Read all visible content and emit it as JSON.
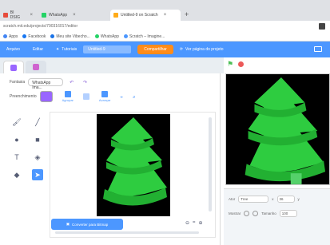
{
  "browser": {
    "tabs": [
      {
        "label": "BI DSIG",
        "favicon_color": "#e74c3c"
      },
      {
        "label": "WhatsApp",
        "favicon_color": "#25d366"
      },
      {
        "label": "Untitled-9 on Scratch",
        "favicon_color": "#ffab19"
      }
    ],
    "new_tab_glyph": "+",
    "close_glyph": "×",
    "url": "scratch.mit.edu/projects/790316017/editor",
    "bookmarks": [
      {
        "label": "Apps",
        "color": "#4285f4"
      },
      {
        "label": "Facebook",
        "color": "#1877f2"
      },
      {
        "label": "Meu site Vibecho...",
        "color": "#1a73e8"
      },
      {
        "label": "WhatsApp",
        "color": "#25d366"
      },
      {
        "label": "Scratch – Imagine...",
        "color": "#4c97ff"
      }
    ]
  },
  "menu": {
    "file": "Arquivo",
    "edit": "Editar",
    "tutorials": "Tutoriais",
    "project_title": "Untitled-9",
    "share": "Compartilhar",
    "see_project": "Ver página do projeto"
  },
  "paint": {
    "costume_label": "Fantasia",
    "costume_name": "WhatsApp Ima...",
    "fill_label": "Preenchimento",
    "group_label": "Agrupar",
    "ungroup_label": "Desagrupar",
    "forward_label": "Avançar",
    "convert_button": "Converter para Bitmap",
    "zoom_out": "⊖",
    "zoom_reset": "=",
    "zoom_in": "⊕"
  },
  "sprite_info": {
    "sprite_label": "Ator",
    "sprite_name": "Tree",
    "x_label": "x",
    "x_value": "36",
    "y_label": "y",
    "y_value": "-24",
    "show_label": "Mostrar",
    "size_label": "Tamanho",
    "size_value": "100"
  },
  "colors": {
    "scratch_blue": "#4c97ff",
    "share_orange": "#ff8c1a",
    "tree_green": "#2ecc40",
    "fill_purple": "#9966ff"
  }
}
